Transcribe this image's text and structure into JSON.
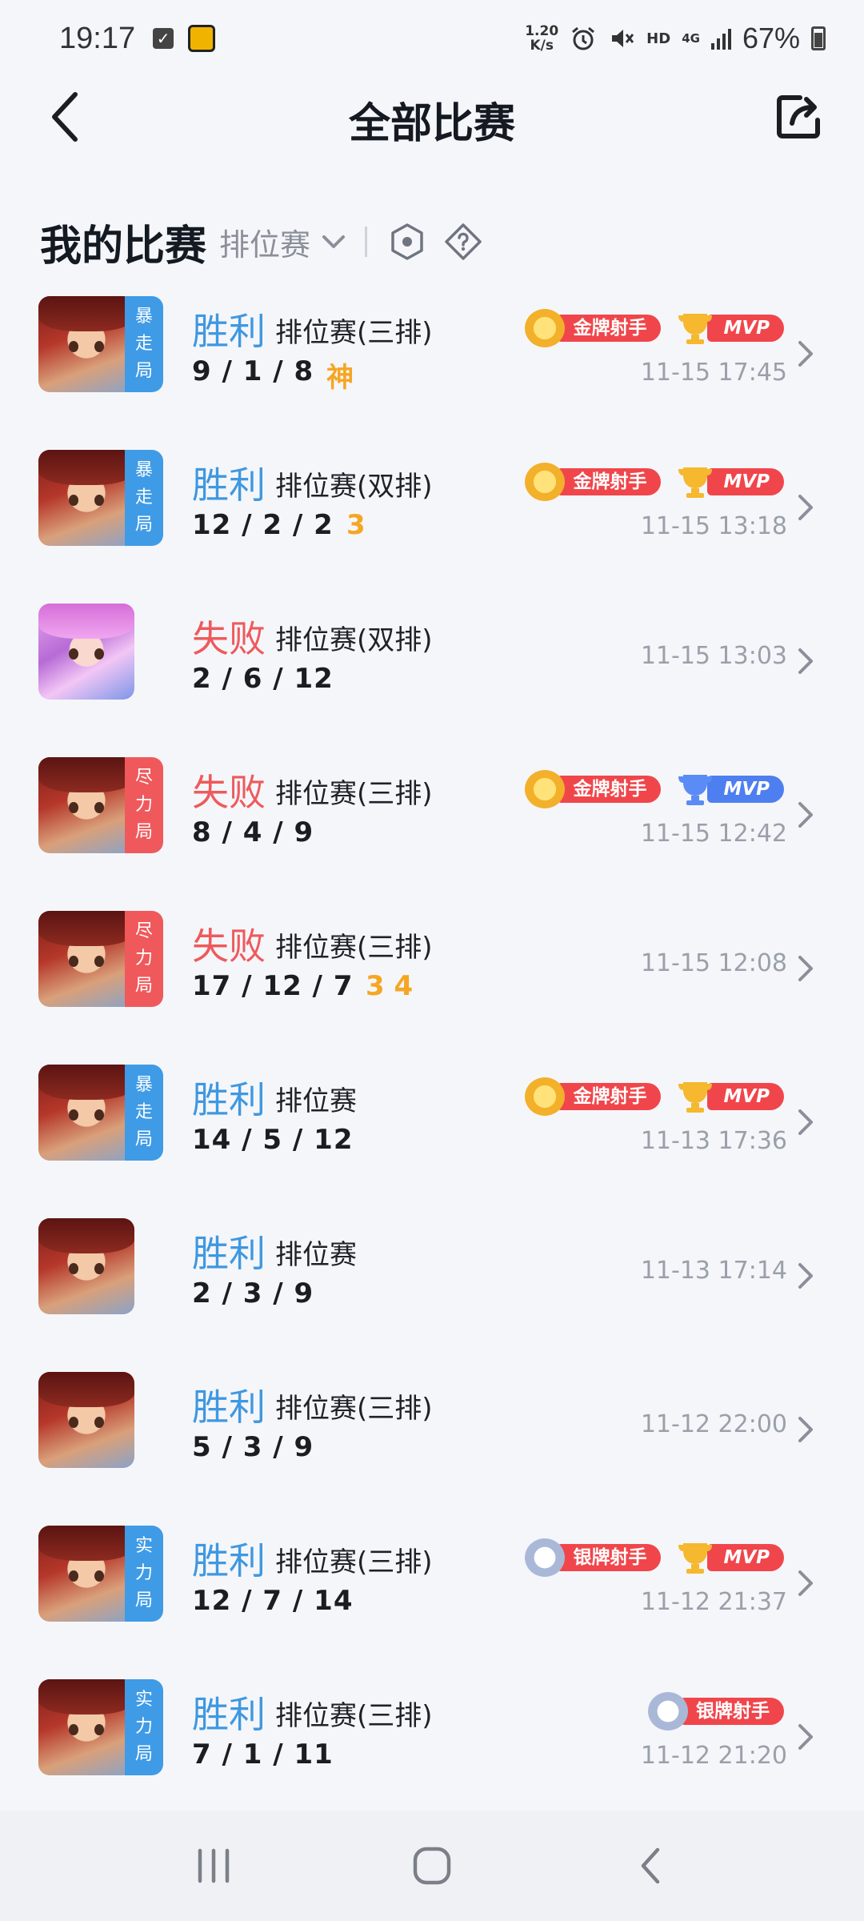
{
  "status_bar": {
    "time": "19:17",
    "speed_top": "1.20",
    "speed_bottom": "K/s",
    "hd": "HD",
    "network": "4G",
    "battery": "67%"
  },
  "header": {
    "title": "全部比赛"
  },
  "section": {
    "title": "我的比赛",
    "filter": "排位赛"
  },
  "matches": [
    {
      "result": "胜利",
      "outcome": "win",
      "mode": "排位赛(三排)",
      "kda": "9 / 1 / 8",
      "extras": "神",
      "time": "11-15 17:45",
      "tag": [
        "暴",
        "走",
        "局"
      ],
      "tag_color": "blue",
      "badges": [
        "金牌射手",
        "MVP"
      ],
      "badge_kinds": [
        "gold",
        "mvp-red"
      ]
    },
    {
      "result": "胜利",
      "outcome": "win",
      "mode": "排位赛(双排)",
      "kda": "12 / 2 / 2",
      "extras": "3",
      "time": "11-15 13:18",
      "tag": [
        "暴",
        "走",
        "局"
      ],
      "tag_color": "blue",
      "badges": [
        "金牌射手",
        "MVP"
      ],
      "badge_kinds": [
        "gold",
        "mvp-red"
      ]
    },
    {
      "result": "失败",
      "outcome": "lose",
      "mode": "排位赛(双排)",
      "kda": "2 / 6 / 12",
      "extras": "",
      "time": "11-15 13:03",
      "tag": [],
      "tag_color": "",
      "badges": [],
      "badge_kinds": []
    },
    {
      "result": "失败",
      "outcome": "lose",
      "mode": "排位赛(三排)",
      "kda": "8 / 4 / 9",
      "extras": "",
      "time": "11-15 12:42",
      "tag": [
        "尽",
        "力",
        "局"
      ],
      "tag_color": "red",
      "badges": [
        "金牌射手",
        "MVP"
      ],
      "badge_kinds": [
        "gold",
        "mvp-blue"
      ]
    },
    {
      "result": "失败",
      "outcome": "lose",
      "mode": "排位赛(三排)",
      "kda": "17 / 12 / 7",
      "extras": "3  4",
      "time": "11-15 12:08",
      "tag": [
        "尽",
        "力",
        "局"
      ],
      "tag_color": "red",
      "badges": [],
      "badge_kinds": []
    },
    {
      "result": "胜利",
      "outcome": "win",
      "mode": "排位赛",
      "kda": "14 / 5 / 12",
      "extras": "",
      "time": "11-13 17:36",
      "tag": [
        "暴",
        "走",
        "局"
      ],
      "tag_color": "blue",
      "badges": [
        "金牌射手",
        "MVP"
      ],
      "badge_kinds": [
        "gold",
        "mvp-red"
      ]
    },
    {
      "result": "胜利",
      "outcome": "win",
      "mode": "排位赛",
      "kda": "2 / 3 / 9",
      "extras": "",
      "time": "11-13 17:14",
      "tag": [],
      "tag_color": "",
      "badges": [],
      "badge_kinds": []
    },
    {
      "result": "胜利",
      "outcome": "win",
      "mode": "排位赛(三排)",
      "kda": "5 / 3 / 9",
      "extras": "",
      "time": "11-12 22:00",
      "tag": [],
      "tag_color": "",
      "badges": [],
      "badge_kinds": []
    },
    {
      "result": "胜利",
      "outcome": "win",
      "mode": "排位赛(三排)",
      "kda": "12 / 7 / 14",
      "extras": "",
      "time": "11-12 21:37",
      "tag": [
        "实",
        "力",
        "局"
      ],
      "tag_color": "blue",
      "badges": [
        "银牌射手",
        "MVP"
      ],
      "badge_kinds": [
        "silver",
        "mvp-red"
      ]
    },
    {
      "result": "胜利",
      "outcome": "win",
      "mode": "排位赛(三排)",
      "kda": "7 / 1 / 11",
      "extras": "",
      "time": "11-12 21:20",
      "tag": [
        "实",
        "力",
        "局"
      ],
      "tag_color": "blue",
      "badges": [
        "银牌射手"
      ],
      "badge_kinds": [
        "silver"
      ]
    }
  ],
  "colors": {
    "win": "#3f98e0",
    "lose": "#ee5a5c",
    "badge_red": "#f0464b",
    "badge_blue": "#4e7ff0",
    "extras": "#f5a623"
  }
}
